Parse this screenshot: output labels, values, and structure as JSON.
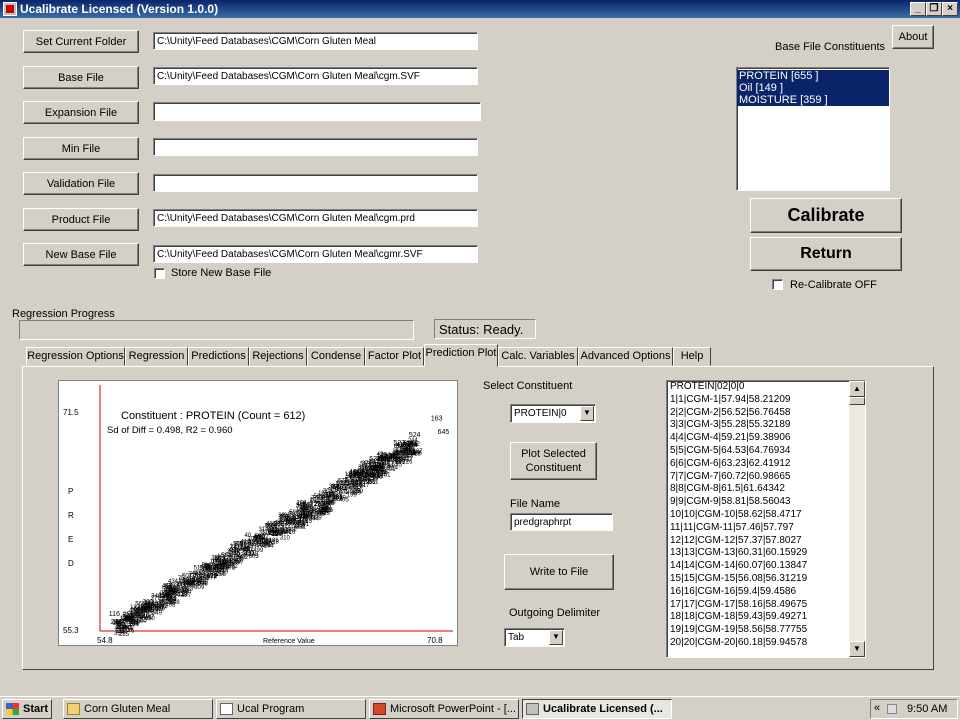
{
  "window": {
    "title": "Ucalibrate Licensed (Version 1.0.0)"
  },
  "left_buttons": [
    {
      "label": "Set Current Folder",
      "value": "C:\\Unity\\Feed Databases\\CGM\\Corn Gluten Meal"
    },
    {
      "label": "Base File",
      "value": "C:\\Unity\\Feed Databases\\CGM\\Corn Gluten Meal\\cgm.SVF"
    },
    {
      "label": "Expansion File",
      "value": ""
    },
    {
      "label": "Min File",
      "value": ""
    },
    {
      "label": "Validation File",
      "value": ""
    },
    {
      "label": "Product File",
      "value": "C:\\Unity\\Feed Databases\\CGM\\Corn Gluten Meal\\cgm.prd"
    },
    {
      "label": "New Base File",
      "value": "C:\\Unity\\Feed Databases\\CGM\\Corn Gluten Meal\\cgmr.SVF"
    }
  ],
  "store_new_base_file": {
    "label": "Store New Base File",
    "checked": false
  },
  "about_label": "About",
  "base_constituents": {
    "label": "Base File Constituents",
    "items": [
      "PROTEIN [655 ]",
      "Oil [149 ]",
      "MOISTURE [359 ]"
    ]
  },
  "calibrate_label": "Calibrate",
  "return_label": "Return",
  "recalibrate": {
    "label": "Re-Calibrate OFF",
    "checked": false
  },
  "progress": {
    "label": "Regression Progress",
    "value": 0
  },
  "status": "Status: Ready.",
  "tabs": [
    "Regression Options",
    "Regression",
    "Predictions",
    "Rejections",
    "Condense",
    "Factor Plot",
    "Prediction Plot",
    "Calc. Variables",
    "Advanced Options",
    "Help"
  ],
  "active_tab": "Prediction Plot",
  "plot_panel": {
    "select_constituent_label": "Select Constituent",
    "selected_constituent": "PROTEIN|0",
    "plot_button_label": "Plot Selected Constituent",
    "file_name_label": "File Name",
    "file_name_value": "predgraphrpt",
    "write_button_label": "Write to File",
    "delimiter_label": "Outgoing Delimiter",
    "delimiter_value": "Tab"
  },
  "chart_data": {
    "type": "scatter",
    "title": "Constituent : PROTEIN (Count = 612)",
    "subtitle": "Sd of Diff = 0.498, R2 = 0.960",
    "xlabel": "Reference Value",
    "ylabel": "PRED",
    "xlim": [
      54.8,
      70.8
    ],
    "ylim": [
      55.3,
      71.5
    ],
    "x_min_label": "54.8",
    "x_max_label": "70.8",
    "y_min_label": "55.3",
    "y_max_label": "71.5",
    "labeled_points": [
      {
        "label": "163",
        "x": 69.8,
        "y": 70.8
      },
      {
        "label": "645",
        "x": 70.1,
        "y": 69.8
      },
      {
        "label": "524",
        "x": 68.8,
        "y": 69.6
      },
      {
        "label": "523",
        "x": 68.1,
        "y": 69.0
      },
      {
        "label": "59",
        "x": 68.7,
        "y": 68.3
      },
      {
        "label": "534",
        "x": 67.0,
        "y": 67.8
      },
      {
        "label": "305",
        "x": 67.8,
        "y": 67.7
      },
      {
        "label": "151",
        "x": 67.2,
        "y": 67.4
      },
      {
        "label": "75",
        "x": 58.8,
        "y": 59.3
      },
      {
        "label": "112",
        "x": 56.4,
        "y": 56.0
      },
      {
        "label": "116",
        "x": 55.2,
        "y": 56.4
      }
    ],
    "point_cloud": {
      "x_center_range": [
        55.5,
        69.0
      ],
      "slope": 1.0,
      "spread": 0.5,
      "count": 612
    }
  },
  "output_lines": [
    "PROTEIN|02|0|0",
    "1|1|CGM-1|57.94|58.21209",
    "2|2|CGM-2|56.52|56.76458",
    "3|3|CGM-3|55.28|55.32189",
    "4|4|CGM-4|59.21|59.38906",
    "5|5|CGM-5|64.53|64.76934",
    "6|6|CGM-6|63.23|62.41912",
    "7|7|CGM-7|60.72|60.98665",
    "8|8|CGM-8|61.5|61.64342",
    "9|9|CGM-9|58.81|58.56043",
    "10|10|CGM-10|58.62|58.4717",
    "11|11|CGM-11|57.46|57.797",
    "12|12|CGM-12|57.37|57.8027",
    "13|13|CGM-13|60.31|60.15929",
    "14|14|CGM-14|60.07|60.13847",
    "15|15|CGM-15|56.08|56.31219",
    "16|16|CGM-16|59.4|59.4586",
    "17|17|CGM-17|58.16|58.49675",
    "18|18|CGM-18|59.43|59.49271",
    "19|19|CGM-19|58.56|58.77755",
    "20|20|CGM-20|60.18|59.94578"
  ],
  "taskbar": {
    "start": "Start",
    "tasks": [
      "Corn Gluten Meal",
      "Ucal Program",
      "Microsoft PowerPoint - [...",
      "Ucalibrate Licensed (..."
    ],
    "active_task": 3,
    "tray_chevron": "«",
    "clock": "9:50 AM"
  }
}
